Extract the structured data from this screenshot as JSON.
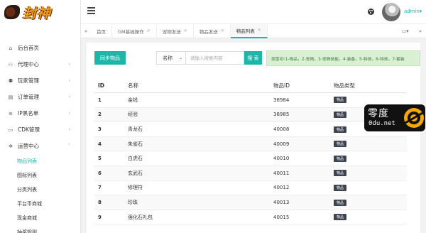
{
  "brand": {
    "logo_text": "封神"
  },
  "sidebar": {
    "items": [
      {
        "label": "后台首页",
        "icon": "home-icon",
        "glyph": "⌂"
      },
      {
        "label": "代理中心",
        "icon": "users-icon",
        "glyph": "⚇"
      },
      {
        "label": "玩家管理",
        "icon": "players-icon",
        "glyph": "⚉"
      },
      {
        "label": "订单管理",
        "icon": "order-icon",
        "glyph": "▤"
      },
      {
        "label": "IP黑名单",
        "icon": "list-icon",
        "glyph": "≡"
      },
      {
        "label": "CDK管理",
        "icon": "cdk-icon",
        "glyph": "▭"
      },
      {
        "label": "运营中心",
        "icon": "gear-icon",
        "glyph": "✲"
      }
    ],
    "subitems": [
      {
        "label": "物品列表"
      },
      {
        "label": "图标列表"
      },
      {
        "label": "分类列表"
      },
      {
        "label": "平台币商城"
      },
      {
        "label": "现金商城"
      },
      {
        "label": "抽奖规则"
      }
    ]
  },
  "header": {
    "username": "admin▾"
  },
  "tabs": [
    {
      "label": "首页"
    },
    {
      "label": "GM基础操作"
    },
    {
      "label": "宠物发送"
    },
    {
      "label": "物品发送"
    },
    {
      "label": "物品列表"
    }
  ],
  "toolbar": {
    "sync_label": "同步物品",
    "select_value": "名称",
    "search_placeholder": "请输入搜索内容",
    "search_label": "搜 索",
    "hint": "类型ID:1-物品，2-宠物，3-宠物技能，4-装备，5-特技，6-特效，7-套装"
  },
  "table": {
    "headers": [
      "ID",
      "名称",
      "物品ID",
      "物品类型"
    ],
    "rows": [
      {
        "id": "1",
        "name": "金钱",
        "item_id": "36984",
        "type": "物品"
      },
      {
        "id": "2",
        "name": "经验",
        "item_id": "36985",
        "type": "物品"
      },
      {
        "id": "3",
        "name": "青龙石",
        "item_id": "40008",
        "type": "物品"
      },
      {
        "id": "4",
        "name": "朱雀石",
        "item_id": "40009",
        "type": "物品"
      },
      {
        "id": "5",
        "name": "白虎石",
        "item_id": "40010",
        "type": "物品"
      },
      {
        "id": "6",
        "name": "玄武石",
        "item_id": "40011",
        "type": "物品"
      },
      {
        "id": "7",
        "name": "修理符",
        "item_id": "40012",
        "type": "物品"
      },
      {
        "id": "8",
        "name": "珍珠",
        "item_id": "40013",
        "type": "物品"
      },
      {
        "id": "9",
        "name": "强化石礼包",
        "item_id": "40015",
        "type": "物品"
      }
    ]
  },
  "watermark": {
    "line1": "零度",
    "line2": "0du.net"
  },
  "colors": {
    "accent": "#1fb5a8",
    "badge": "#3d4450",
    "hint_bg": "#d9f0d2"
  }
}
